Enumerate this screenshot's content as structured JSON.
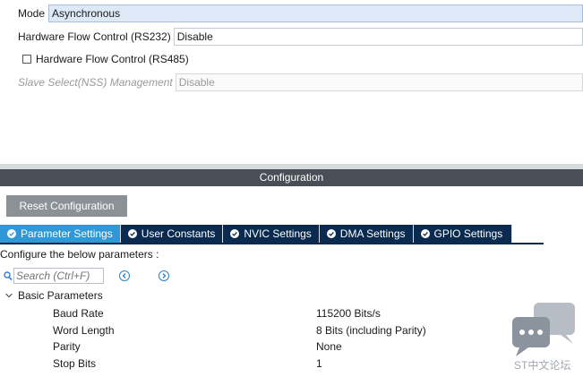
{
  "mode": {
    "label": "Mode",
    "value": "Asynchronous"
  },
  "hardware_flow_rs232": {
    "label": "Hardware Flow Control (RS232)",
    "value": "Disable"
  },
  "hardware_flow_rs485": {
    "label": "Hardware Flow Control (RS485)",
    "checked": false
  },
  "slave_select": {
    "label": "Slave Select(NSS) Management",
    "value": "Disable"
  },
  "configuration": {
    "title": "Configuration",
    "reset_label": "Reset Configuration",
    "tabs": [
      {
        "label": "Parameter Settings",
        "active": true
      },
      {
        "label": "User Constants",
        "active": false
      },
      {
        "label": "NVIC Settings",
        "active": false
      },
      {
        "label": "DMA Settings",
        "active": false
      },
      {
        "label": "GPIO Settings",
        "active": false
      }
    ],
    "configure_text": "Configure the below parameters :",
    "search_placeholder": "Search (Ctrl+F)",
    "section_title": "Basic Parameters",
    "params": [
      {
        "name": "Baud Rate",
        "value": "115200 Bits/s"
      },
      {
        "name": "Word Length",
        "value": "8 Bits (including Parity)"
      },
      {
        "name": "Parity",
        "value": "None"
      },
      {
        "name": "Stop Bits",
        "value": "1"
      }
    ]
  },
  "watermark": {
    "text": "ST中文论坛"
  },
  "colors": {
    "active_tab": "#2f98d6",
    "tab_dark": "#0a2a4f",
    "header_bar": "#4a4f57",
    "reset_button": "#8c9198",
    "mode_field_bg": "#dde9f6"
  },
  "icons": {
    "tab_check": "check-circle-icon",
    "search": "search-icon",
    "prev": "chevron-left-circle-icon",
    "next": "chevron-right-circle-icon",
    "section": "chevron-down-icon",
    "logo": "chat-bubble-icon"
  }
}
